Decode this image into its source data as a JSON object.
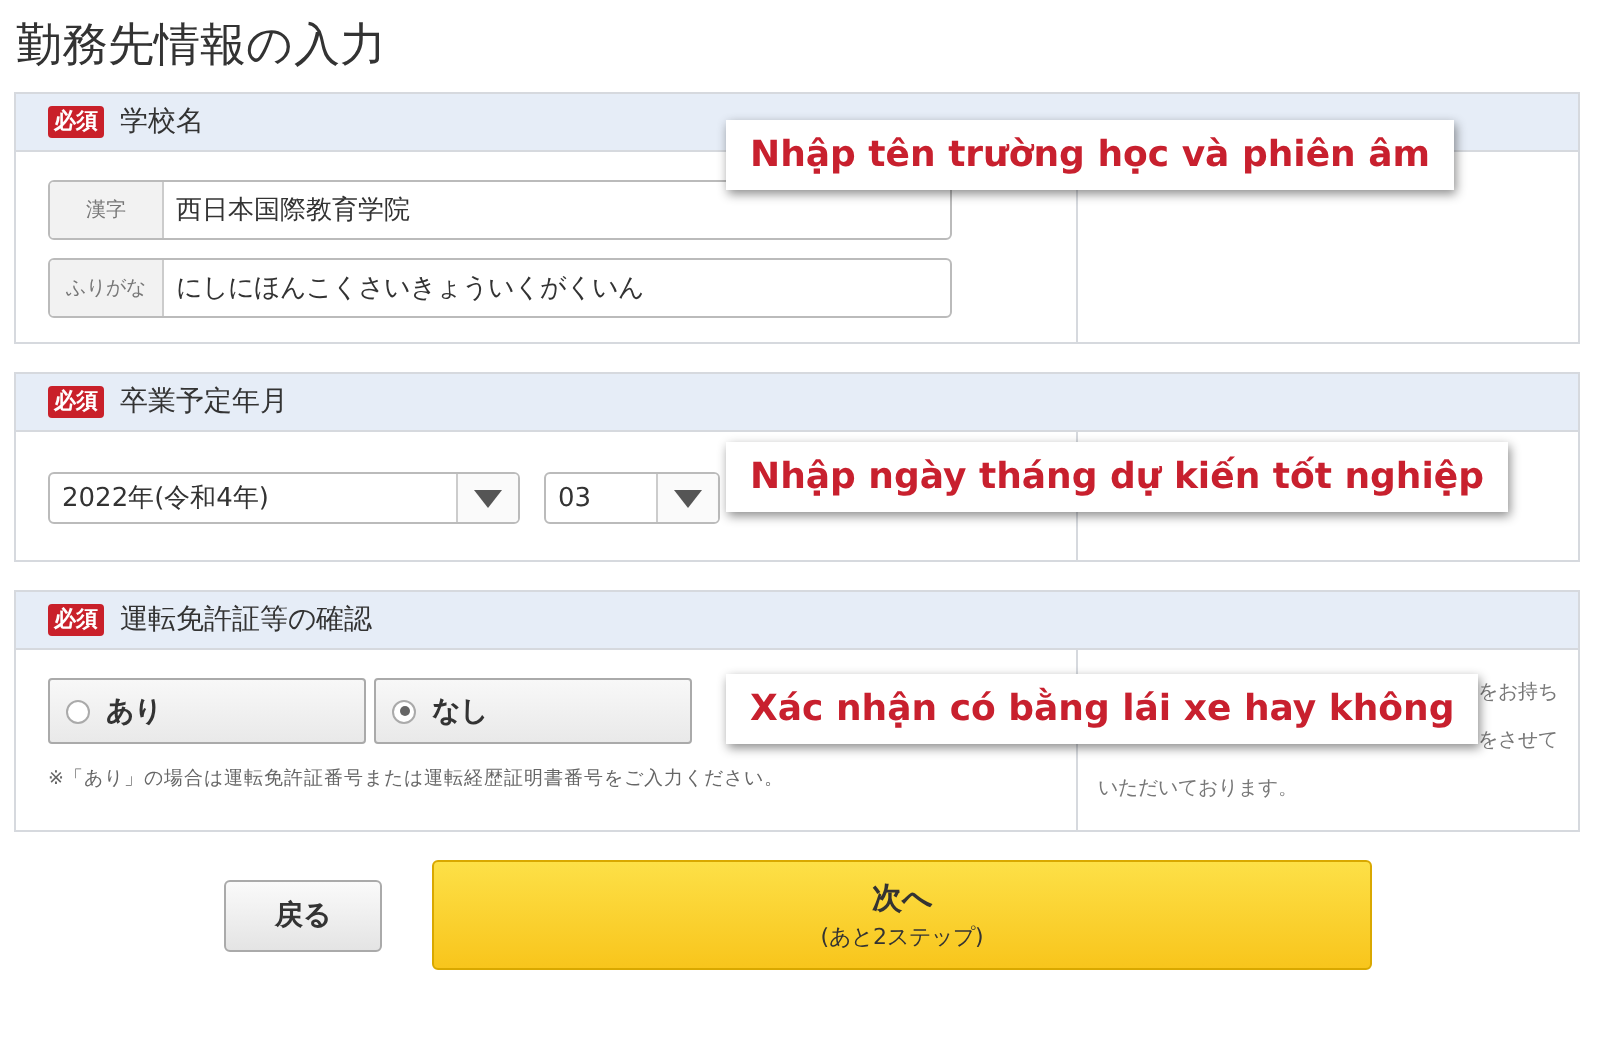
{
  "page_title": "勤務先情報の入力",
  "sections": [
    {
      "kind": "text_fields",
      "badge": "必須",
      "title": "学校名",
      "fields": [
        {
          "label": "漢字",
          "value": "西日本国際教育学院"
        },
        {
          "label": "ふりがな",
          "value": "にしにほんこくさいきょういくがくいん"
        }
      ],
      "callout": "Nhập tên trường học và phiên âm"
    },
    {
      "kind": "selects",
      "badge": "必須",
      "title": "卒業予定年月",
      "selects": [
        {
          "value": "2022年(令和4年)"
        },
        {
          "value": "03"
        }
      ],
      "callout": "Nhập ngày tháng dự kiến tốt nghiệp"
    },
    {
      "kind": "radios",
      "badge": "必須",
      "title": "運転免許証等の確認",
      "options": [
        {
          "label": "あり",
          "selected": false
        },
        {
          "label": "なし",
          "selected": true
        }
      ],
      "note": "※「あり」の場合は運転免許証番号または運転経歴証明書番号をご入力ください。",
      "side_note": [
        "をお持ち",
        "をさせて",
        "いただいております。"
      ],
      "callout": "Xác nhận có bằng lái xe hay không"
    }
  ],
  "buttons": {
    "back": "戻る",
    "next": "次へ",
    "next_sub": "(あと2ステップ)"
  }
}
